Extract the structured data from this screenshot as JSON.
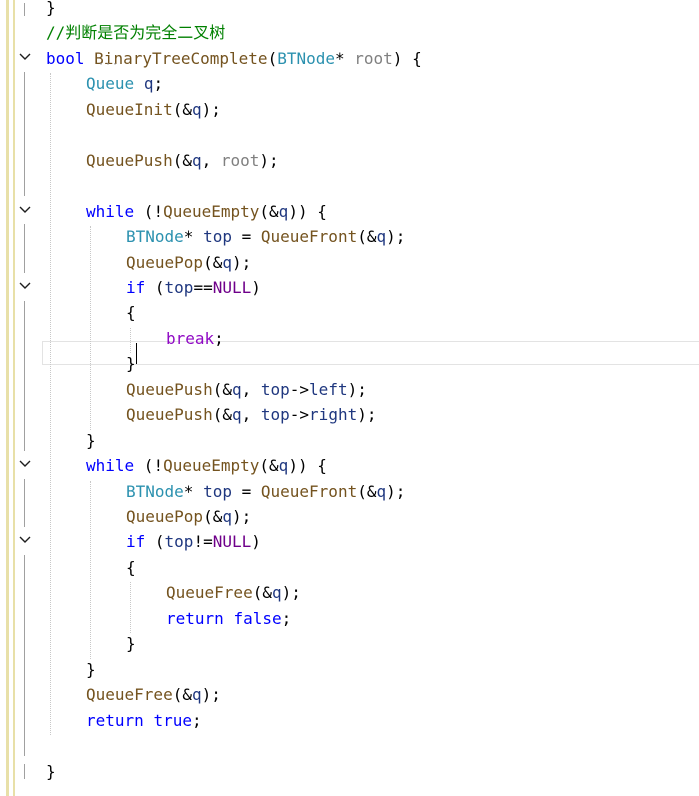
{
  "editor": {
    "lines": [
      {
        "indent": 0,
        "tokens": [
          {
            "t": "}",
            "c": "op"
          }
        ]
      },
      {
        "indent": 0,
        "tokens": [
          {
            "t": "//判断是否为完全二叉树",
            "c": "cm"
          }
        ]
      },
      {
        "indent": 0,
        "tokens": [
          {
            "t": "bool",
            "c": "kw"
          },
          {
            "t": " ",
            "c": "op"
          },
          {
            "t": "BinaryTreeComplete",
            "c": "fn"
          },
          {
            "t": "(",
            "c": "op"
          },
          {
            "t": "BTNode",
            "c": "ty"
          },
          {
            "t": "* ",
            "c": "op"
          },
          {
            "t": "root",
            "c": "pr"
          },
          {
            "t": ") {",
            "c": "op"
          }
        ]
      },
      {
        "indent": 1,
        "tokens": [
          {
            "t": "Queue",
            "c": "ty"
          },
          {
            "t": " ",
            "c": "op"
          },
          {
            "t": "q",
            "c": "va"
          },
          {
            "t": ";",
            "c": "op"
          }
        ]
      },
      {
        "indent": 1,
        "tokens": [
          {
            "t": "QueueInit",
            "c": "fn"
          },
          {
            "t": "(&",
            "c": "op"
          },
          {
            "t": "q",
            "c": "va"
          },
          {
            "t": ");",
            "c": "op"
          }
        ]
      },
      {
        "indent": 0,
        "tokens": []
      },
      {
        "indent": 1,
        "tokens": [
          {
            "t": "QueuePush",
            "c": "fn"
          },
          {
            "t": "(&",
            "c": "op"
          },
          {
            "t": "q",
            "c": "va"
          },
          {
            "t": ", ",
            "c": "op"
          },
          {
            "t": "root",
            "c": "pr"
          },
          {
            "t": ");",
            "c": "op"
          }
        ]
      },
      {
        "indent": 0,
        "tokens": []
      },
      {
        "indent": 1,
        "tokens": [
          {
            "t": "while",
            "c": "kw"
          },
          {
            "t": " (!",
            "c": "op"
          },
          {
            "t": "QueueEmpty",
            "c": "fn"
          },
          {
            "t": "(&",
            "c": "op"
          },
          {
            "t": "q",
            "c": "va"
          },
          {
            "t": ")) {",
            "c": "op"
          }
        ]
      },
      {
        "indent": 2,
        "tokens": [
          {
            "t": "BTNode",
            "c": "ty"
          },
          {
            "t": "* ",
            "c": "op"
          },
          {
            "t": "top",
            "c": "va"
          },
          {
            "t": " = ",
            "c": "op"
          },
          {
            "t": "QueueFront",
            "c": "fn"
          },
          {
            "t": "(&",
            "c": "op"
          },
          {
            "t": "q",
            "c": "va"
          },
          {
            "t": ");",
            "c": "op"
          }
        ]
      },
      {
        "indent": 2,
        "tokens": [
          {
            "t": "QueuePop",
            "c": "fn"
          },
          {
            "t": "(&",
            "c": "op"
          },
          {
            "t": "q",
            "c": "va"
          },
          {
            "t": ");",
            "c": "op"
          }
        ]
      },
      {
        "indent": 2,
        "tokens": [
          {
            "t": "if",
            "c": "kw"
          },
          {
            "t": " (",
            "c": "op"
          },
          {
            "t": "top",
            "c": "va"
          },
          {
            "t": "==",
            "c": "op"
          },
          {
            "t": "NULL",
            "c": "mu"
          },
          {
            "t": ")",
            "c": "op"
          }
        ]
      },
      {
        "indent": 2,
        "tokens": [
          {
            "t": "{",
            "c": "op"
          }
        ]
      },
      {
        "indent": 3,
        "tokens": [
          {
            "t": "break",
            "c": "mc"
          },
          {
            "t": ";",
            "c": "op"
          }
        ]
      },
      {
        "indent": 2,
        "tokens": [
          {
            "t": "}",
            "c": "op"
          }
        ]
      },
      {
        "indent": 2,
        "tokens": [
          {
            "t": "QueuePush",
            "c": "fn"
          },
          {
            "t": "(&",
            "c": "op"
          },
          {
            "t": "q",
            "c": "va"
          },
          {
            "t": ", ",
            "c": "op"
          },
          {
            "t": "top",
            "c": "va"
          },
          {
            "t": "->",
            "c": "op"
          },
          {
            "t": "left",
            "c": "va"
          },
          {
            "t": ");",
            "c": "op"
          }
        ]
      },
      {
        "indent": 2,
        "tokens": [
          {
            "t": "QueuePush",
            "c": "fn"
          },
          {
            "t": "(&",
            "c": "op"
          },
          {
            "t": "q",
            "c": "va"
          },
          {
            "t": ", ",
            "c": "op"
          },
          {
            "t": "top",
            "c": "va"
          },
          {
            "t": "->",
            "c": "op"
          },
          {
            "t": "right",
            "c": "va"
          },
          {
            "t": ");",
            "c": "op"
          }
        ]
      },
      {
        "indent": 1,
        "tokens": [
          {
            "t": "}",
            "c": "op"
          }
        ]
      },
      {
        "indent": 1,
        "tokens": [
          {
            "t": "while",
            "c": "kw"
          },
          {
            "t": " (!",
            "c": "op"
          },
          {
            "t": "QueueEmpty",
            "c": "fn"
          },
          {
            "t": "(&",
            "c": "op"
          },
          {
            "t": "q",
            "c": "va"
          },
          {
            "t": ")) {",
            "c": "op"
          }
        ]
      },
      {
        "indent": 2,
        "tokens": [
          {
            "t": "BTNode",
            "c": "ty"
          },
          {
            "t": "* ",
            "c": "op"
          },
          {
            "t": "top",
            "c": "va"
          },
          {
            "t": " = ",
            "c": "op"
          },
          {
            "t": "QueueFront",
            "c": "fn"
          },
          {
            "t": "(&",
            "c": "op"
          },
          {
            "t": "q",
            "c": "va"
          },
          {
            "t": ");",
            "c": "op"
          }
        ]
      },
      {
        "indent": 2,
        "tokens": [
          {
            "t": "QueuePop",
            "c": "fn"
          },
          {
            "t": "(&",
            "c": "op"
          },
          {
            "t": "q",
            "c": "va"
          },
          {
            "t": ");",
            "c": "op"
          }
        ]
      },
      {
        "indent": 2,
        "tokens": [
          {
            "t": "if",
            "c": "kw"
          },
          {
            "t": " (",
            "c": "op"
          },
          {
            "t": "top",
            "c": "va"
          },
          {
            "t": "!=",
            "c": "op"
          },
          {
            "t": "NULL",
            "c": "mu"
          },
          {
            "t": ")",
            "c": "op"
          }
        ]
      },
      {
        "indent": 2,
        "tokens": [
          {
            "t": "{",
            "c": "op"
          }
        ]
      },
      {
        "indent": 3,
        "tokens": [
          {
            "t": "QueueFree",
            "c": "fn"
          },
          {
            "t": "(&",
            "c": "op"
          },
          {
            "t": "q",
            "c": "va"
          },
          {
            "t": ");",
            "c": "op"
          }
        ]
      },
      {
        "indent": 3,
        "tokens": [
          {
            "t": "return",
            "c": "kw"
          },
          {
            "t": " ",
            "c": "op"
          },
          {
            "t": "false",
            "c": "kw"
          },
          {
            "t": ";",
            "c": "op"
          }
        ]
      },
      {
        "indent": 2,
        "tokens": [
          {
            "t": "}",
            "c": "op"
          }
        ]
      },
      {
        "indent": 1,
        "tokens": [
          {
            "t": "}",
            "c": "op"
          }
        ]
      },
      {
        "indent": 1,
        "tokens": [
          {
            "t": "QueueFree",
            "c": "fn"
          },
          {
            "t": "(&",
            "c": "op"
          },
          {
            "t": "q",
            "c": "va"
          },
          {
            "t": ");",
            "c": "op"
          }
        ]
      },
      {
        "indent": 1,
        "tokens": [
          {
            "t": "return",
            "c": "kw"
          },
          {
            "t": " ",
            "c": "op"
          },
          {
            "t": "true",
            "c": "kw"
          },
          {
            "t": ";",
            "c": "op"
          }
        ]
      },
      {
        "indent": 0,
        "tokens": []
      },
      {
        "indent": 0,
        "tokens": [
          {
            "t": "}",
            "c": "op"
          }
        ]
      }
    ],
    "fold_lines": [
      2,
      8,
      11,
      18,
      21
    ],
    "fold_icon": "chevron-down-icon"
  }
}
